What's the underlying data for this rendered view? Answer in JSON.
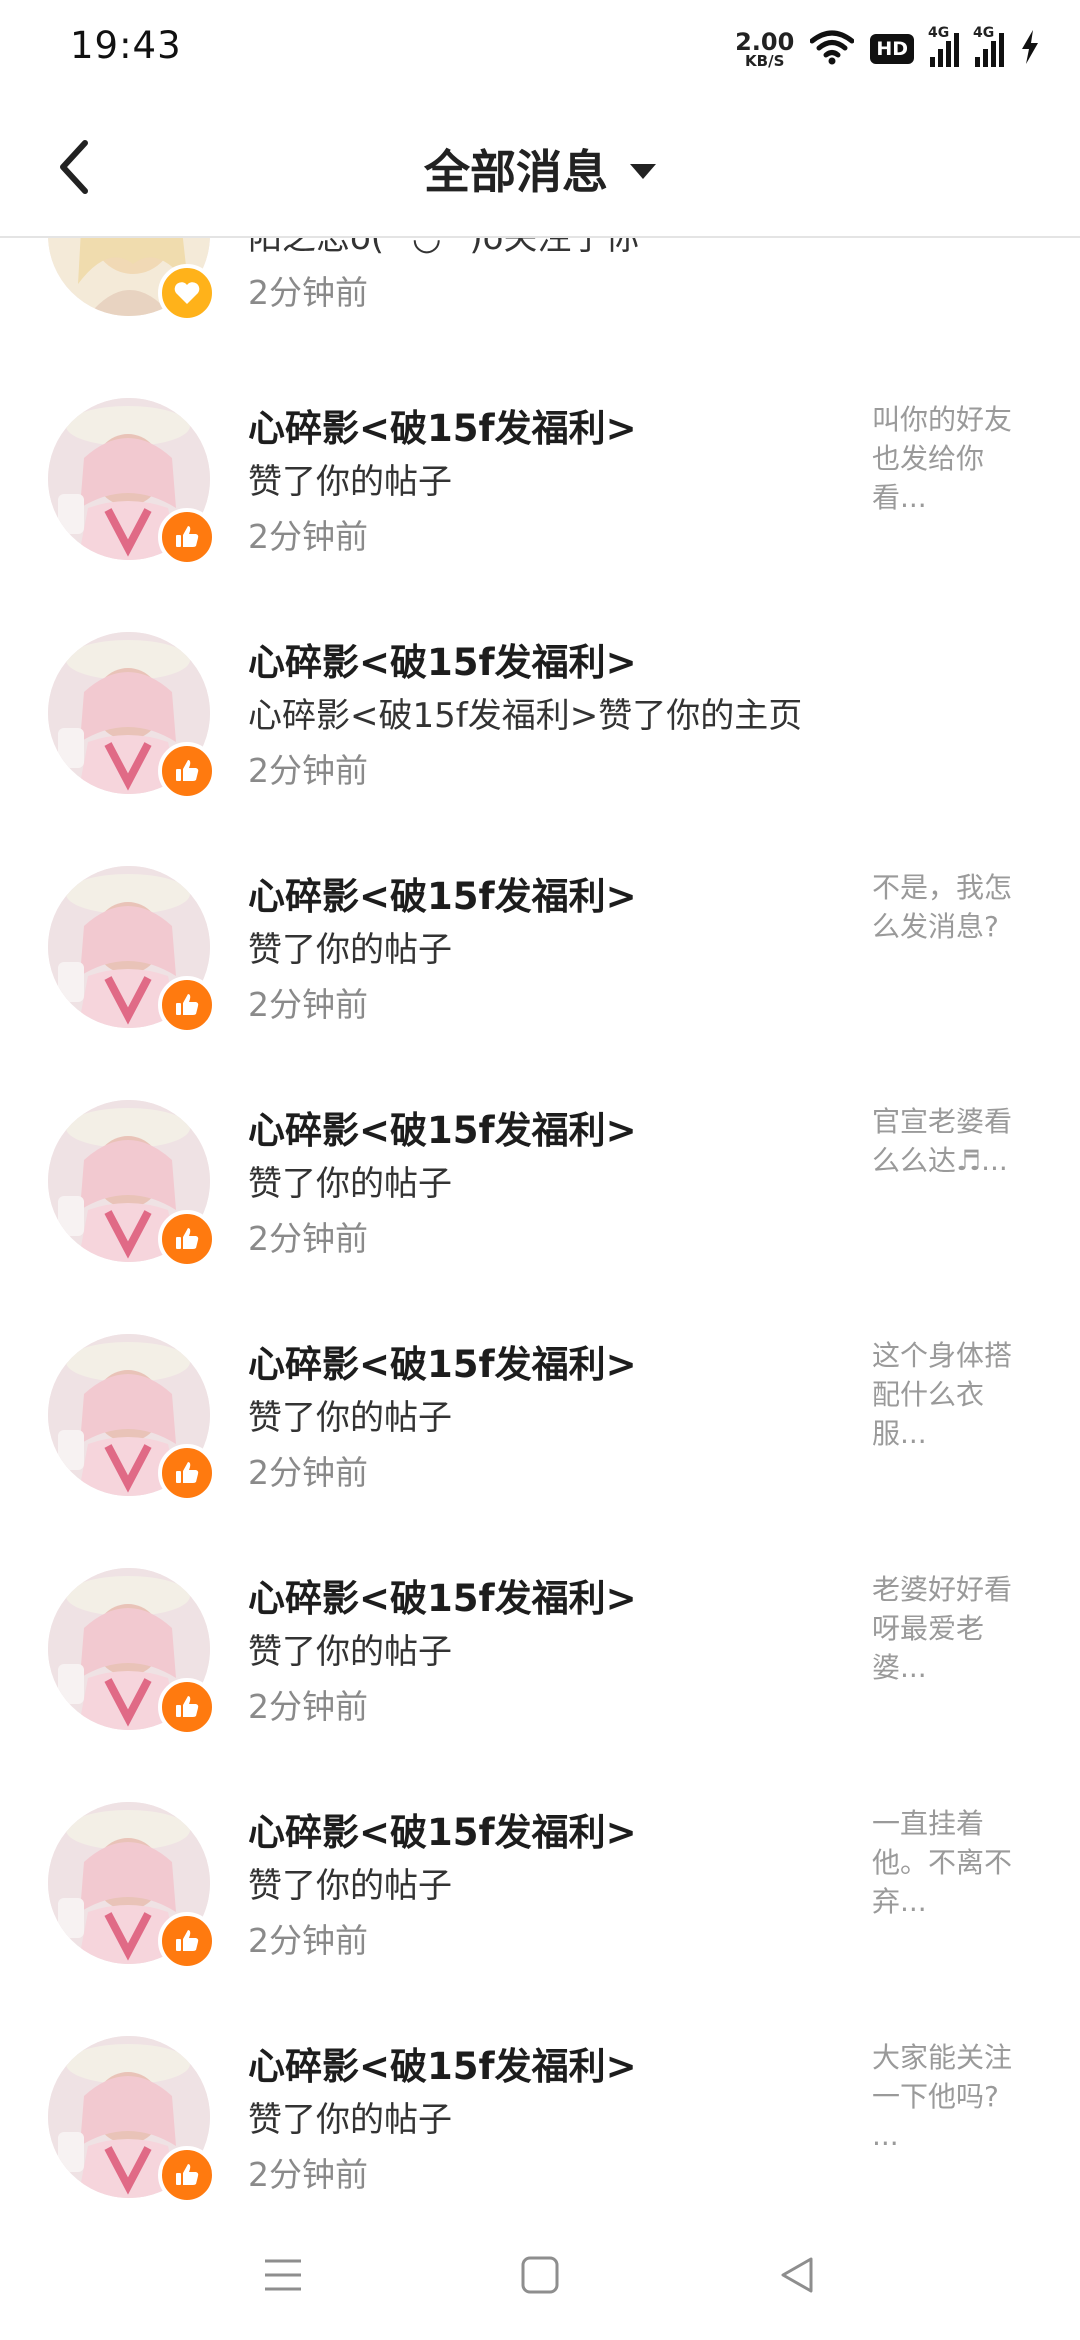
{
  "status_bar": {
    "time": "19:43",
    "net_speed_value": "2.00",
    "net_speed_unit": "KB/S",
    "hd_badge": "HD",
    "signal_label_1": "4G",
    "signal_label_2": "4G",
    "icons": [
      "wifi-icon",
      "hd-icon",
      "signal-icon",
      "signal-icon",
      "charging-icon"
    ]
  },
  "header": {
    "title": "全部消息",
    "back_icon": "chevron-left-icon",
    "dropdown_icon": "caret-down-icon"
  },
  "colors": {
    "like_badge": "#ff7a0f",
    "follow_badge": "#ffb21a",
    "time_text": "#8a8a8a",
    "preview_text": "#9a9a9a"
  },
  "messages": [
    {
      "name": "",
      "action": "阳之恋o( ˘◡˘ )o关注了你",
      "time": "2分钟前",
      "preview": "",
      "badge": "heart-icon"
    },
    {
      "name": "心碎影<破15f发福利>",
      "action": "赞了你的帖子",
      "time": "2分钟前",
      "preview": "叫你的好友也发给你看...",
      "badge": "thumbs-up-icon"
    },
    {
      "name": "心碎影<破15f发福利>",
      "action": "心碎影<破15f发福利>赞了你的主页",
      "time": "2分钟前",
      "preview": "",
      "badge": "thumbs-up-icon"
    },
    {
      "name": "心碎影<破15f发福利>",
      "action": "赞了你的帖子",
      "time": "2分钟前",
      "preview": "不是，我怎么发消息?",
      "badge": "thumbs-up-icon"
    },
    {
      "name": "心碎影<破15f发福利>",
      "action": "赞了你的帖子",
      "time": "2分钟前",
      "preview": "官宣老婆看么么达♬...",
      "badge": "thumbs-up-icon"
    },
    {
      "name": "心碎影<破15f发福利>",
      "action": "赞了你的帖子",
      "time": "2分钟前",
      "preview": "这个身体搭配什么衣服...",
      "badge": "thumbs-up-icon"
    },
    {
      "name": "心碎影<破15f发福利>",
      "action": "赞了你的帖子",
      "time": "2分钟前",
      "preview": "老婆好好看呀最爱老婆...",
      "badge": "thumbs-up-icon"
    },
    {
      "name": "心碎影<破15f发福利>",
      "action": "赞了你的帖子",
      "time": "2分钟前",
      "preview": "一直挂着他。不离不弃...",
      "badge": "thumbs-up-icon"
    },
    {
      "name": "心碎影<破15f发福利>",
      "action": "赞了你的帖子",
      "time": "2分钟前",
      "preview": "大家能关注一下他吗? ...",
      "badge": "thumbs-up-icon"
    }
  ],
  "nav_bar": {
    "icons": [
      "menu-icon",
      "home-square-icon",
      "back-triangle-icon"
    ]
  }
}
